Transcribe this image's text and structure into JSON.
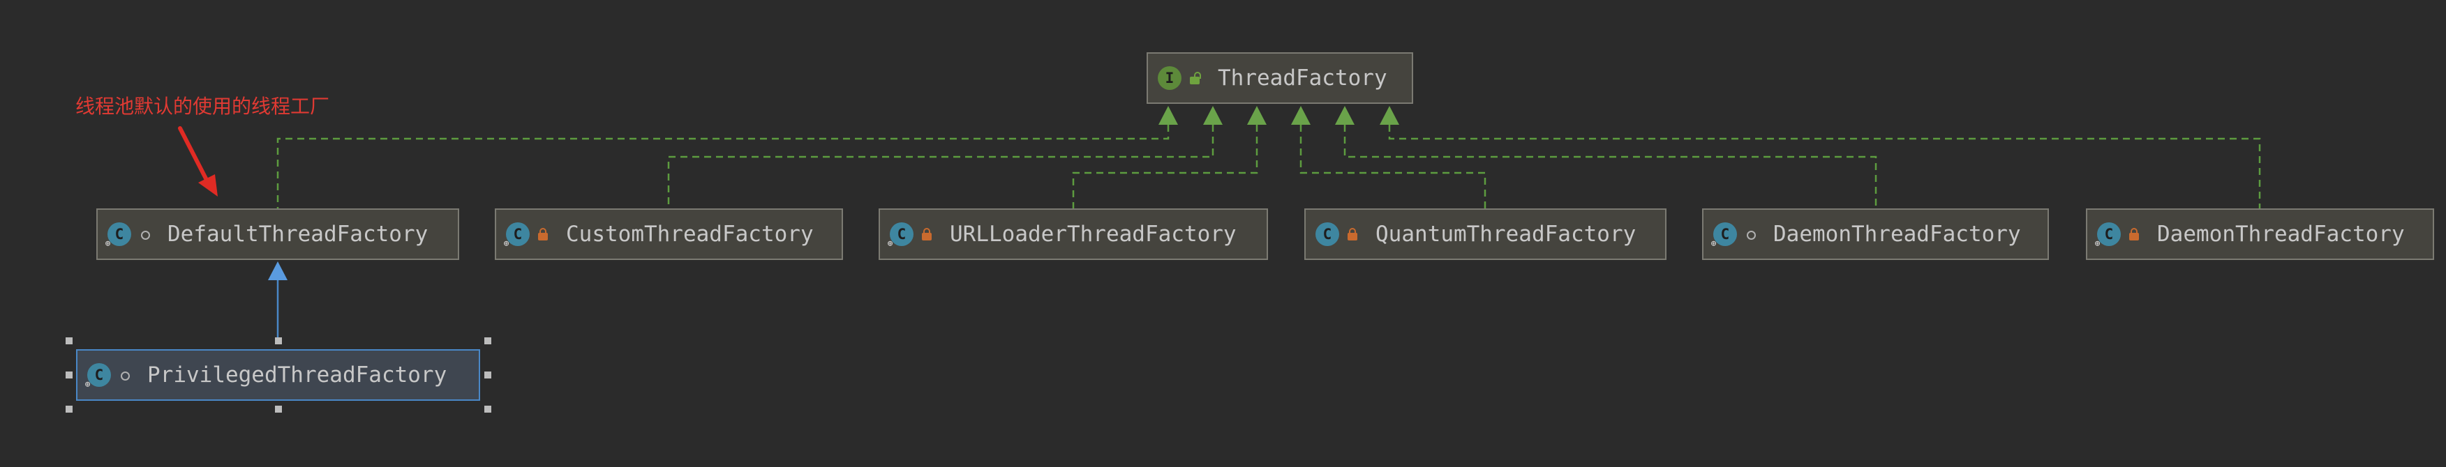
{
  "interface": {
    "name": "ThreadFactory",
    "icon": "interface-icon",
    "visibility": "public-unlock-icon"
  },
  "classes": [
    {
      "name": "DefaultThreadFactory",
      "icon": "class-icon",
      "visibility": "package-private-icon"
    },
    {
      "name": "CustomThreadFactory",
      "icon": "class-icon",
      "visibility": "private-lock-icon"
    },
    {
      "name": "URLLoaderThreadFactory",
      "icon": "class-icon",
      "visibility": "private-lock-icon"
    },
    {
      "name": "QuantumThreadFactory",
      "icon": "class-icon",
      "visibility": "private-lock-icon"
    },
    {
      "name": "DaemonThreadFactory",
      "icon": "class-icon",
      "visibility": "package-private-icon"
    },
    {
      "name": "DaemonThreadFactory",
      "icon": "class-icon",
      "visibility": "private-lock-icon"
    }
  ],
  "subclass": {
    "name": "PrivilegedThreadFactory",
    "icon": "class-icon",
    "visibility": "package-private-icon",
    "selected": true
  },
  "annotation": {
    "text": "线程池默认的使用的线程工厂"
  },
  "colors": {
    "background": "#2b2b2b",
    "node_fill": "#45443e",
    "node_border": "#7b7a72",
    "implements_line": "#5d9c3f",
    "extends_line": "#4a88c7",
    "annotation": "#e03a33"
  }
}
